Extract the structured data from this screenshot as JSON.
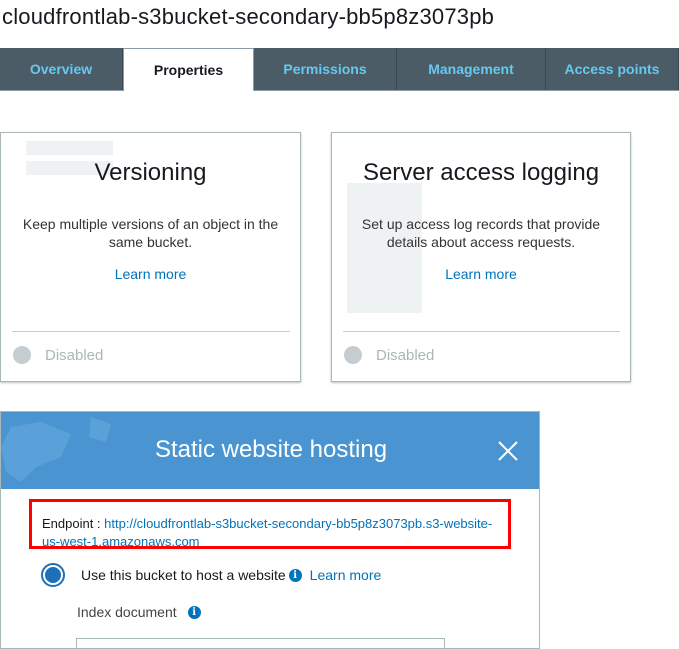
{
  "bucket": {
    "title": "cloudfrontlab-s3bucket-secondary-bb5p8z3073pb"
  },
  "tabs": [
    {
      "label": "Overview"
    },
    {
      "label": "Properties"
    },
    {
      "label": "Permissions"
    },
    {
      "label": "Management"
    },
    {
      "label": "Access points"
    }
  ],
  "cards": {
    "versioning": {
      "title": "Versioning",
      "description": "Keep multiple versions of an object in the same bucket.",
      "link": "Learn more",
      "status": "Disabled"
    },
    "logging": {
      "title": "Server access logging",
      "description": "Set up access log records that provide details about access requests.",
      "link": "Learn more",
      "status": "Disabled"
    }
  },
  "modal": {
    "title": "Static website hosting",
    "endpoint_label": "Endpoint : ",
    "endpoint_url": "http://cloudfrontlab-s3bucket-secondary-bb5p8z3073pb.s3-website-us-west-1.amazonaws.com",
    "radio_label": "Use this bucket to host a website",
    "learn_more": "Learn more",
    "index_label": "Index document",
    "index_value": ""
  },
  "icons": {
    "info": "i",
    "close": "close-icon"
  },
  "colors": {
    "tab_bg": "#4b5c66",
    "tab_text": "#66c9ef",
    "modal_header": "#4a95d1",
    "link": "#0073bb",
    "highlight": "#ff0000"
  }
}
